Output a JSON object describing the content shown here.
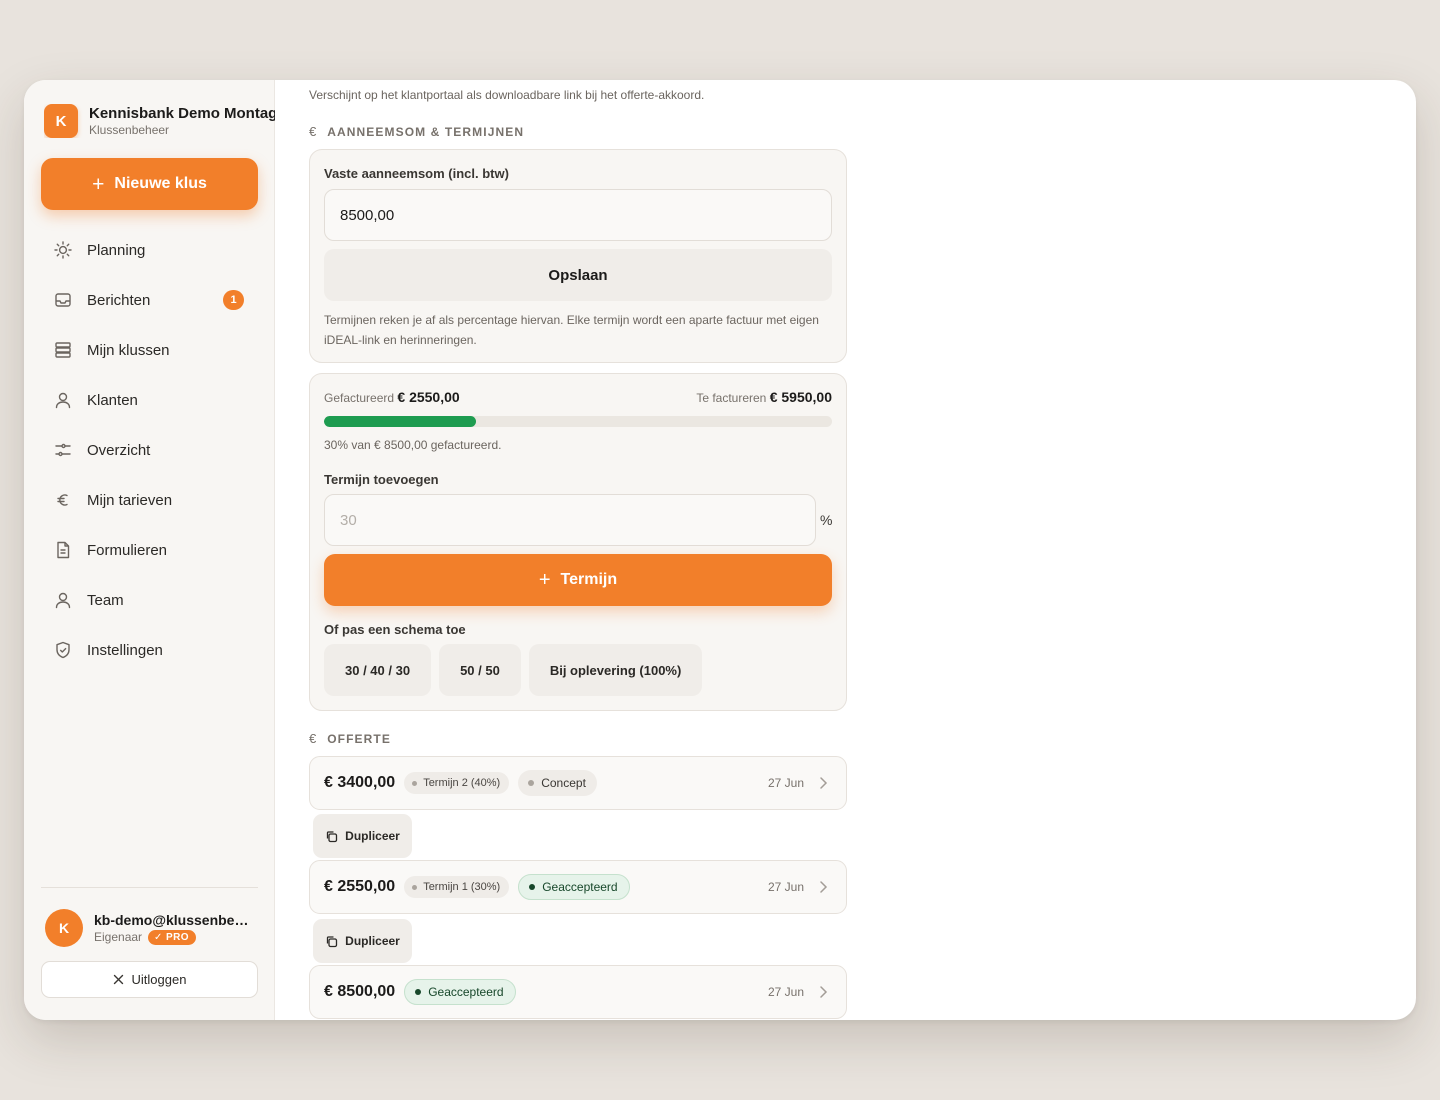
{
  "brand": {
    "initial": "K",
    "name": "Kennisbank Demo Montage",
    "subtitle": "Klussenbeheer"
  },
  "new_job_label": "Nieuwe klus",
  "nav": [
    {
      "label": "Planning",
      "icon": "sun-icon"
    },
    {
      "label": "Berichten",
      "icon": "inbox-icon",
      "badge": "1"
    },
    {
      "label": "Mijn klussen",
      "icon": "layers-icon"
    },
    {
      "label": "Klanten",
      "icon": "user-icon"
    },
    {
      "label": "Overzicht",
      "icon": "sliders-icon"
    },
    {
      "label": "Mijn tarieven",
      "icon": "euro-icon"
    },
    {
      "label": "Formulieren",
      "icon": "document-icon"
    },
    {
      "label": "Team",
      "icon": "user-icon"
    },
    {
      "label": "Instellingen",
      "icon": "shield-check-icon"
    }
  ],
  "user": {
    "initial": "K",
    "email": "kb-demo@klussenbeheer.nl",
    "role": "Eigenaar",
    "plan": "PRO"
  },
  "logout_label": "Uitloggen",
  "main": {
    "top_hint": "Verschijnt op het klantportaal als downloadbare link bij het offerte-akkoord.",
    "section_contract": "AANNEEMSOM & TERMIJNEN",
    "contract_label": "Vaste aanneemsom (incl. btw)",
    "contract_value": "8500,00",
    "save_label": "Opslaan",
    "contract_info": "Termijnen reken je af als percentage hiervan. Elke termijn wordt een aparte factuur met eigen iDEAL-link en herinneringen.",
    "invoiced_label": "Gefactureerd",
    "invoiced_value": "€ 2550,00",
    "to_invoice_label": "Te factureren",
    "to_invoice_value": "€ 5950,00",
    "progress_fraction": 0.3,
    "progress_caption": "30% van € 8500,00 gefactureerd.",
    "add_term_label": "Termijn toevoegen",
    "add_term_placeholder": "30",
    "percent_sign": "%",
    "add_term_button": "Termijn",
    "schema_label": "Of pas een schema toe",
    "schemas": [
      "30 / 40 / 30",
      "50 / 50",
      "Bij oplevering (100%)"
    ],
    "section_quote": "OFFERTE",
    "duplicate_label": "Dupliceer",
    "offers": [
      {
        "amount": "€ 3400,00",
        "term": "Termijn 2 (40%)",
        "status": "Concept",
        "accepted": false,
        "date": "27 Jun"
      },
      {
        "amount": "€ 2550,00",
        "term": "Termijn 1 (30%)",
        "status": "Geaccepteerd",
        "accepted": true,
        "date": "27 Jun"
      },
      {
        "amount": "€ 8500,00",
        "term": "",
        "status": "Geaccepteerd",
        "accepted": true,
        "date": "27 Jun"
      }
    ]
  },
  "colors": {
    "accent": "#f27f2a",
    "progress": "#1e9c50",
    "accepted_text": "#17472a"
  }
}
